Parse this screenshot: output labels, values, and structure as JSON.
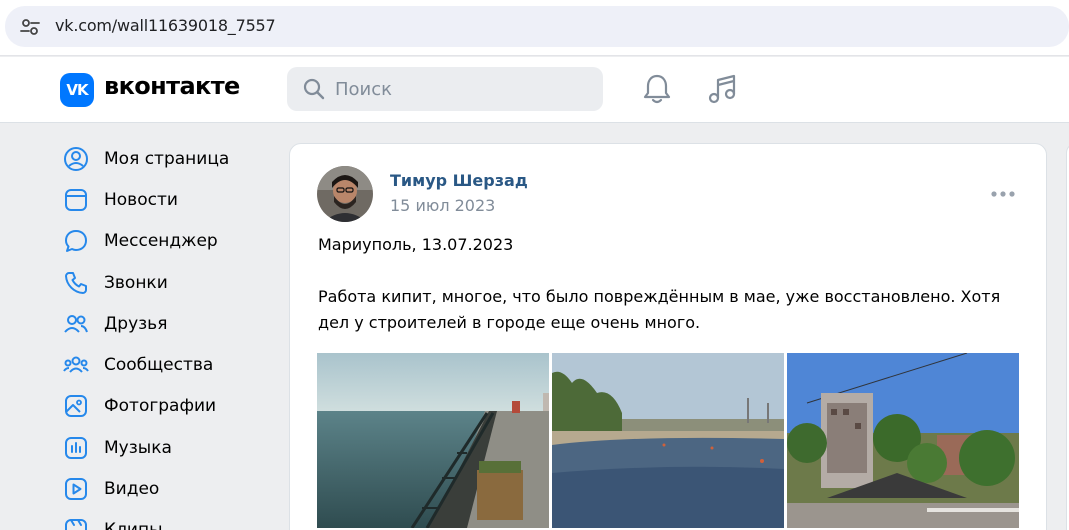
{
  "browser": {
    "url": "vk.com/wall11639018_7557"
  },
  "header": {
    "logo_text": "VK",
    "brand": "вконтакте",
    "search_placeholder": "Поиск"
  },
  "nav": {
    "items": [
      {
        "label": "Моя страница",
        "icon": "profile-icon"
      },
      {
        "label": "Новости",
        "icon": "news-icon"
      },
      {
        "label": "Мессенджер",
        "icon": "messenger-icon"
      },
      {
        "label": "Звонки",
        "icon": "phone-icon"
      },
      {
        "label": "Друзья",
        "icon": "friends-icon"
      },
      {
        "label": "Сообщества",
        "icon": "communities-icon"
      },
      {
        "label": "Фотографии",
        "icon": "photos-icon"
      },
      {
        "label": "Музыка",
        "icon": "music-icon"
      },
      {
        "label": "Видео",
        "icon": "video-icon"
      },
      {
        "label": "Клипы",
        "icon": "clips-icon"
      }
    ]
  },
  "post": {
    "author": "Тимур Шерзад",
    "date": "15 июл 2023",
    "text_line1": "Мариуполь, 13.07.2023",
    "text_line2": "Работа кипит, многое, что было повреждённым в мае, уже восстановлено. Хотя",
    "text_line3": "дел у строителей в городе еще очень много.",
    "photos": [
      "pier-photo",
      "beach-photo",
      "building-photo"
    ]
  },
  "colors": {
    "accent": "#0077ff",
    "link": "#2a5885",
    "secondary_text": "#818c99",
    "nav_icon": "#2688eb",
    "background": "#edeef0"
  }
}
